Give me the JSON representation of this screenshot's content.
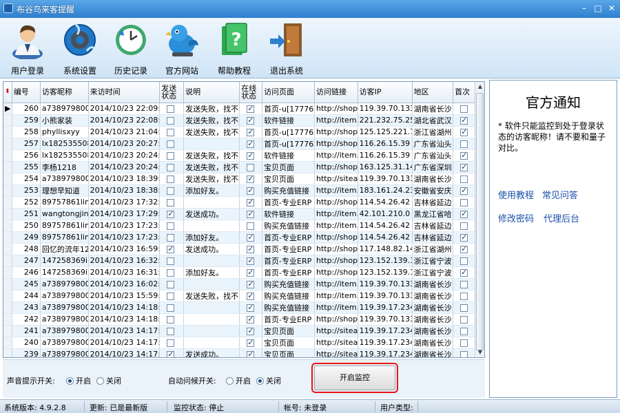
{
  "window": {
    "title": "布谷鸟来客提醒",
    "min_glyph": "–",
    "max_glyph": "□",
    "close_glyph": "✕"
  },
  "toolbar": [
    {
      "name": "login",
      "label": "用户登录",
      "icon": "user-icon"
    },
    {
      "name": "settings",
      "label": "系统设置",
      "icon": "gear-globe-icon"
    },
    {
      "name": "history",
      "label": "历史记录",
      "icon": "clock-icon"
    },
    {
      "name": "website",
      "label": "官方网站",
      "icon": "bird-icon"
    },
    {
      "name": "help",
      "label": "帮助教程",
      "icon": "help-book-icon"
    },
    {
      "name": "exit",
      "label": "退出系统",
      "icon": "door-exit-icon"
    }
  ],
  "grid": {
    "columns": [
      "编号",
      "访客昵称",
      "来访时间",
      "发送状态",
      "说明",
      "在线状态",
      "访问页面",
      "访问链接",
      "访客IP",
      "地区",
      "首次"
    ],
    "rows": [
      {
        "id": "260",
        "nick": "a738979800",
        "time": "2014/10/23 22:09:29",
        "sent": false,
        "note": "发送失败，找不",
        "online": true,
        "page": "首页-u[177765",
        "link": "http://shop1(",
        "ip": "119.39.70.133",
        "area": "湖南省长沙",
        "first": false
      },
      {
        "id": "259",
        "nick": "小熊家装",
        "time": "2014/10/23 22:08:01",
        "sent": false,
        "note": "发送失败，找不",
        "online": true,
        "page": "软件链接",
        "link": "http://item.ta",
        "ip": "221.232.75.25",
        "area": "湖北省武汉",
        "first": true
      },
      {
        "id": "258",
        "nick": "phyllisxyy",
        "time": "2014/10/23 21:04:50",
        "sent": false,
        "note": "发送失败，找不",
        "online": true,
        "page": "首页-u[177765",
        "link": "http://shop1(",
        "ip": "125.125.221.70",
        "area": "浙江省湖州",
        "first": true
      },
      {
        "id": "257",
        "nick": "lx18253550880",
        "time": "2014/10/23 20:27:25",
        "sent": false,
        "note": "",
        "online": true,
        "page": "首页-u[177765",
        "link": "http://shop1(",
        "ip": "116.26.15.39",
        "area": "广东省汕头",
        "first": false
      },
      {
        "id": "256",
        "nick": "lx18253550880",
        "time": "2014/10/23 20:24:45",
        "sent": false,
        "note": "发送失败，找不",
        "online": true,
        "page": "软件链接",
        "link": "http://item.ta",
        "ip": "116.26.15.39",
        "area": "广东省汕头",
        "first": true
      },
      {
        "id": "255",
        "nick": "李杨1218",
        "time": "2014/10/23 20:24:06",
        "sent": false,
        "note": "发送失败，找不",
        "online": false,
        "page": "宝贝页面",
        "link": "http://shop1(",
        "ip": "163.125.31.147",
        "area": "广东省深圳",
        "first": true
      },
      {
        "id": "254",
        "nick": "a738979800",
        "time": "2014/10/23 18:39:20",
        "sent": false,
        "note": "发送失败，找不",
        "online": true,
        "page": "宝贝页面",
        "link": "http://sitead",
        "ip": "119.39.70.133",
        "area": "湖南省长沙",
        "first": false
      },
      {
        "id": "253",
        "nick": "理想早知道",
        "time": "2014/10/23 18:38:36",
        "sent": false,
        "note": "添加好友。",
        "online": true,
        "page": "购买充值链接",
        "link": "http://item.ta",
        "ip": "183.161.24.230",
        "area": "安徽省安庆",
        "first": true
      },
      {
        "id": "252",
        "nick": "89757861linui",
        "time": "2014/10/23 17:32:51",
        "sent": false,
        "note": "",
        "online": true,
        "page": "首页-专业ERP",
        "link": "http://shop1(",
        "ip": "114.54.26.42",
        "area": "吉林省延边",
        "first": false
      },
      {
        "id": "251",
        "nick": "wangtongjing123",
        "time": "2014/10/23 17:29:56",
        "sent": true,
        "note": "发送成功。",
        "online": true,
        "page": "软件链接",
        "link": "http://item.ta",
        "ip": "42.101.210.0",
        "area": "黑龙江省哈",
        "first": true
      },
      {
        "id": "250",
        "nick": "89757861linui",
        "time": "2014/10/23 17:23:47",
        "sent": false,
        "note": "",
        "online": false,
        "page": "购买充值链接",
        "link": "http://item.ta",
        "ip": "114.54.26.42",
        "area": "吉林省延边",
        "first": false
      },
      {
        "id": "249",
        "nick": "89757861linui",
        "time": "2014/10/23 17:23:30",
        "sent": false,
        "note": "添加好友。",
        "online": true,
        "page": "首页-专业ERP",
        "link": "http://shop1(",
        "ip": "114.54.26.42",
        "area": "吉林省延边",
        "first": true
      },
      {
        "id": "248",
        "nick": "回忆的流年123",
        "time": "2014/10/23 16:59:51",
        "sent": true,
        "note": "发送成功。",
        "online": true,
        "page": "首页-专业ERP",
        "link": "http://shop1(",
        "ip": "117.148.82.148",
        "area": "浙江省湖州",
        "first": true
      },
      {
        "id": "247",
        "nick": "147258369i",
        "time": "2014/10/23 16:32:03",
        "sent": false,
        "note": "",
        "online": true,
        "page": "首页-专业ERP",
        "link": "http://shop1(",
        "ip": "123.152.139.141",
        "area": "浙江省宁波",
        "first": false
      },
      {
        "id": "246",
        "nick": "147258369i",
        "time": "2014/10/23 16:31:56",
        "sent": false,
        "note": "添加好友。",
        "online": true,
        "page": "首页-专业ERP",
        "link": "http://shop1(",
        "ip": "123.152.139.141",
        "area": "浙江省宁波",
        "first": true
      },
      {
        "id": "245",
        "nick": "a738979800",
        "time": "2014/10/23 16:02:35",
        "sent": false,
        "note": "",
        "online": true,
        "page": "购买充值链接",
        "link": "http://item.ta",
        "ip": "119.39.70.133",
        "area": "湖南省长沙",
        "first": false
      },
      {
        "id": "244",
        "nick": "a738979800",
        "time": "2014/10/23 15:59:56",
        "sent": false,
        "note": "发送失败，找不",
        "online": true,
        "page": "购买充值链接",
        "link": "http://item.ta",
        "ip": "119.39.70.133",
        "area": "湖南省长沙",
        "first": false
      },
      {
        "id": "243",
        "nick": "a738979800",
        "time": "2014/10/23 14:18:26",
        "sent": false,
        "note": "",
        "online": true,
        "page": "购买充值链接",
        "link": "http://item.ta",
        "ip": "119.39.17.234",
        "area": "湖南省长沙",
        "first": false
      },
      {
        "id": "242",
        "nick": "a738979800",
        "time": "2014/10/23 14:18:01",
        "sent": false,
        "note": "",
        "online": true,
        "page": "首页-专业ERP",
        "link": "http://shop1(",
        "ip": "119.39.70.133",
        "area": "湖南省长沙",
        "first": false
      },
      {
        "id": "241",
        "nick": "a738979800",
        "time": "2014/10/23 14:17:36",
        "sent": false,
        "note": "",
        "online": true,
        "page": "宝贝页面",
        "link": "http://sitead",
        "ip": "119.39.17.234",
        "area": "湖南省长沙",
        "first": false
      },
      {
        "id": "240",
        "nick": "a738979800",
        "time": "2014/10/23 14:17:30",
        "sent": false,
        "note": "",
        "online": true,
        "page": "宝贝页面",
        "link": "http://sitead",
        "ip": "119.39.17.234",
        "area": "湖南省长沙",
        "first": false
      },
      {
        "id": "239",
        "nick": "a738979800",
        "time": "2014/10/23 14:17:18",
        "sent": true,
        "note": "发送成功。",
        "online": true,
        "page": "宝贝页面",
        "link": "http://sitead",
        "ip": "119.39.17.234",
        "area": "湖南省长沙",
        "first": false
      }
    ]
  },
  "options": {
    "sound_label": "声音提示开关:",
    "autoreply_label": "自动问候开关:",
    "on": "开启",
    "off": "关闭",
    "sound_on": true,
    "autoreply_on": false,
    "start_button": "开启监控"
  },
  "notice": {
    "title": "官方通知",
    "body": "* 软件只能监控到处于登录状态的访客昵称！请不要和量子对比。",
    "links": [
      "使用教程",
      "常见问答",
      "修改密码",
      "代理后台"
    ]
  },
  "status": {
    "version": "系统版本: 4.9.2.8",
    "update": "更新: 已是最新版",
    "monitor": "监控状态: 停止",
    "account": "帐号: 未登录",
    "user_type": "用户类型:"
  }
}
